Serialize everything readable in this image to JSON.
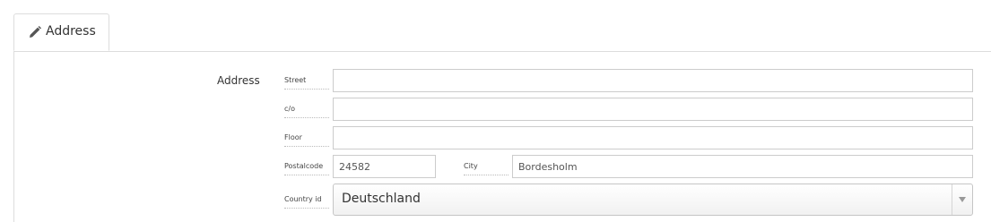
{
  "tabs": [
    {
      "label": "Address",
      "icon": "pencil-icon",
      "active": true
    }
  ],
  "form": {
    "group_label": "Address",
    "fields": {
      "street": {
        "label": "Street",
        "value": ""
      },
      "co": {
        "label": "c/o",
        "value": ""
      },
      "floor": {
        "label": "Floor",
        "value": ""
      },
      "postalcode": {
        "label": "Postalcode",
        "value": "24582"
      },
      "city": {
        "label": "City",
        "value": "Bordesholm"
      },
      "country": {
        "label": "Country id",
        "value": "Deutschland"
      }
    }
  }
}
